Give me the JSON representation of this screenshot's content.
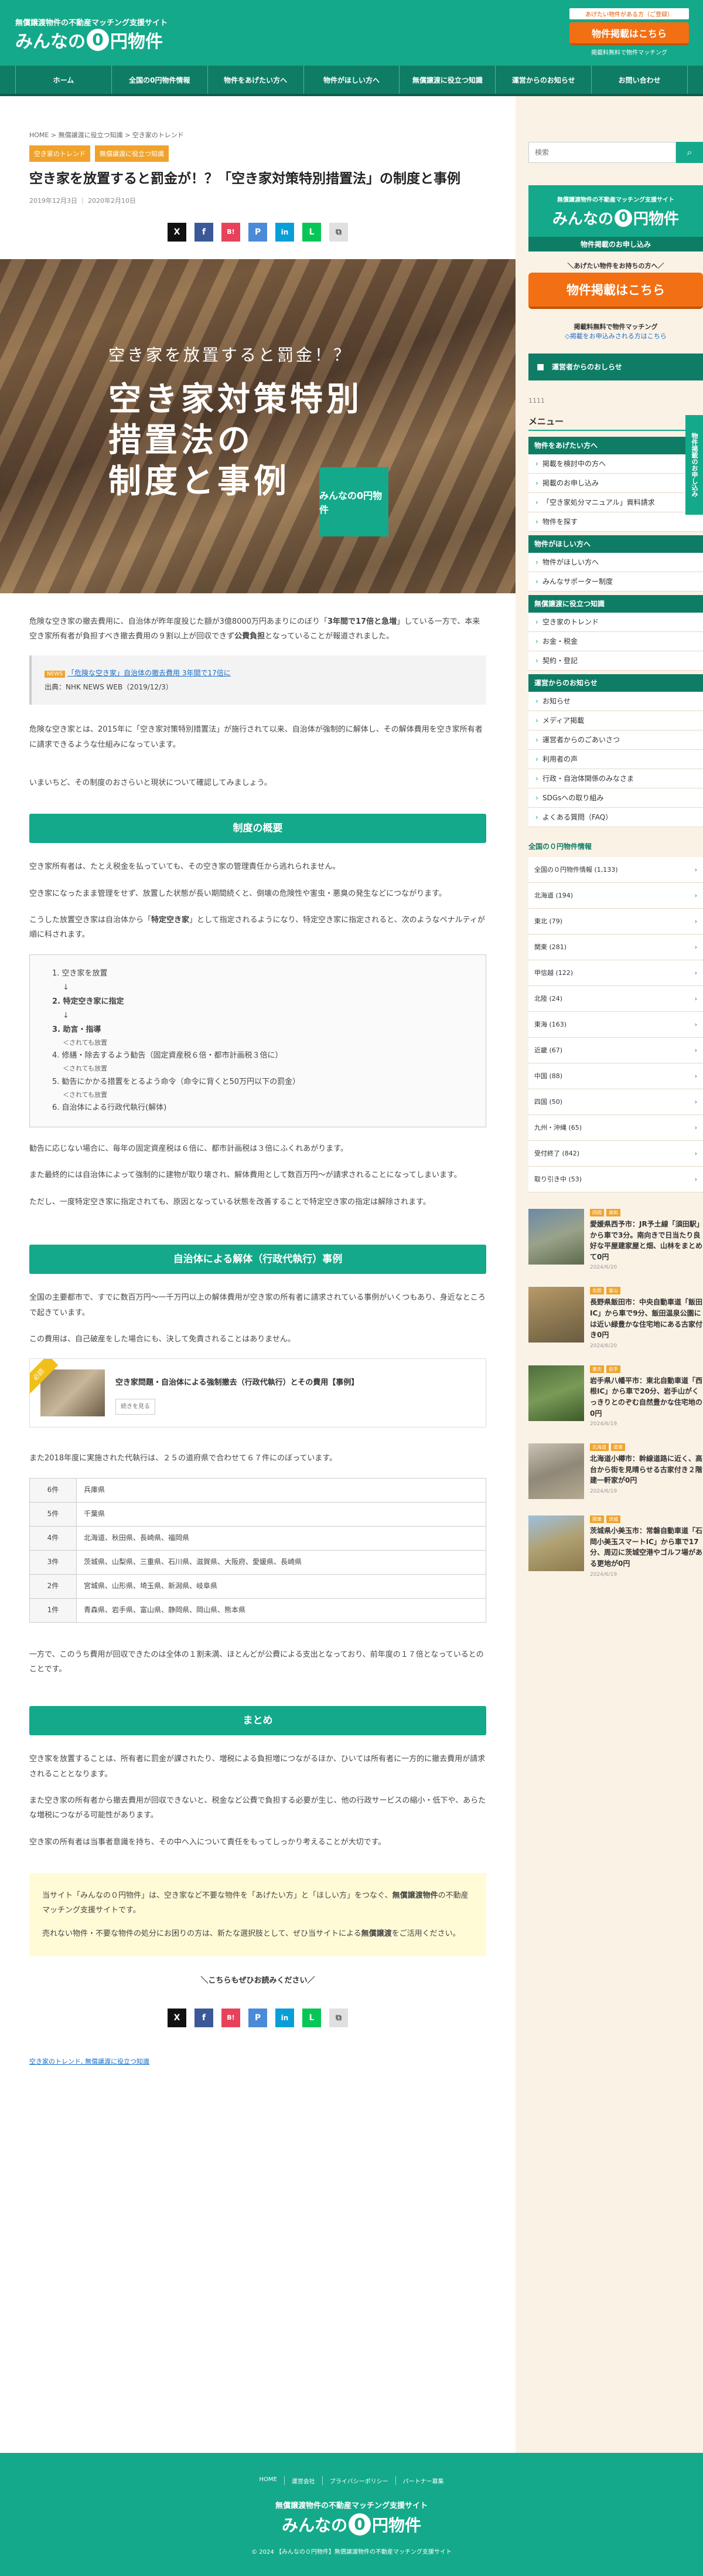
{
  "header": {
    "tagline": "無償譲渡物件の不動産マッチング支援サイト",
    "logo_pre": "みんなの",
    "logo_zero": "0",
    "logo_post": "円物件",
    "small": "あげたい物件がある方（ご登録）",
    "cta": "物件掲載はこちら",
    "cta_sub": "掲載料無料で物件マッチング"
  },
  "nav": [
    "ホーム",
    "全国の0円物件情報",
    "物件をあげたい方へ",
    "物件がほしい方へ",
    "無償譲渡に役立つ知識",
    "運営からのお知らせ",
    "お問い合わせ"
  ],
  "breadcrumb": "HOME > 無償譲渡に役立つ知識 > 空き家のトレンド",
  "tags": [
    "空き家のトレンド",
    "無償譲渡に役立つ知識"
  ],
  "title": "空き家を放置すると罰金が！？「空き家対策特別措置法」の制度と事例",
  "date": "2019年12月3日 ｜ 2020年2月10日",
  "share": [
    "X",
    "f",
    "B!",
    "P",
    "in",
    "L",
    "⧉"
  ],
  "hero": {
    "lead": "空き家を放置すると罰金！？",
    "lines": [
      "空き家対策特別",
      "措置法の",
      "制度と事例"
    ],
    "badge": "みんなの0円物件"
  },
  "intro": {
    "p1a": "危険な空き家の撤去費用に、自治体が昨年度投じた額が3億8000万円あまりにのぼり「",
    "p1b": "3年間で17倍と急増",
    "p1c": "」している一方で、本来空き家所有者が負担すべき撤去費用の９割以上が回収できず",
    "p1d": "公費負担",
    "p1e": "となっていることが報道されました。",
    "quote_tag": "",
    "quote_link": "「危険な空き家」自治体の撤去費用 3年間で17倍に",
    "quote_src": "出典：NHK NEWS WEB（2019/12/3）",
    "p2": "危険な空き家とは、2015年に「空き家対策特別措置法」が施行されて以来、自治体が強制的に解体し、その解体費用を空き家所有者に請求できるような仕組みになっています。",
    "p3": "いまいちど、その制度のおさらいと現状について確認してみましょう。"
  },
  "sec1": {
    "heading": "制度の概要",
    "p1": "空き家所有者は、たとえ税金を払っていても、その空き家の管理責任から逃れられません。",
    "p2": "空き家になったまま管理をせず、放置した状態が長い期間続くと、倒壊の危険性や害虫・悪臭の発生などにつながります。",
    "p3a": "こうした放置空き家は自治体から「",
    "p3b": "特定空き家",
    "p3c": "」として指定されるようになり、特定空き家に指定されると、次のようなペナルティが順に科されます。",
    "list": [
      {
        "text": "1. 空き家を放置",
        "note": ""
      },
      {
        "text": "2. 特定空き家に指定",
        "note": ""
      },
      {
        "text": "3. 助言・指導",
        "note": "＜されても放置"
      },
      {
        "text": "4. 修繕・除去するよう勧告（固定資産税６倍・都市計画税３倍に）",
        "note": "＜されても放置"
      },
      {
        "text": "5. 勧告にかかる措置をとるよう命令（命令に背くと50万円以下の罰金）",
        "note": "＜されても放置"
      },
      {
        "text": "6. 自治体による行政代執行(解体)",
        "note": ""
      }
    ],
    "arrow": "↓",
    "p4": "勧告に応じない場合に、毎年の固定資産税は６倍に、都市計画税は３倍にふくれあがります。",
    "p5": "また最終的には自治体によって強制的に建物が取り壊され、解体費用として数百万円～が請求されることになってしまいます。",
    "p6": "ただし、一度特定空き家に指定されても、原因となっている状態を改善することで特定空き家の指定は解除されます。"
  },
  "sec2": {
    "heading": "自治体による解体（行政代執行）事例",
    "p1": "全国の主要都市で、すでに数百万円〜一千万円以上の解体費用が空き家の所有者に請求されている事例がいくつもあり、身近なところで起きています。",
    "p2": "この費用は、自己破産をした場合にも、決して免責されることはありません。",
    "card_ribbon": "必読",
    "card_title": "空き家問題・自治体による強制撤去（行政代執行）とその費用【事例】",
    "card_btn": "続きを見る",
    "p3": "また2018年度に実施された代執行は、２５の道府県で合わせて６７件にのぼっています。",
    "table": [
      [
        "6件",
        "兵庫県"
      ],
      [
        "5件",
        "千葉県"
      ],
      [
        "4件",
        "北海道、秋田県、長崎県、福岡県"
      ],
      [
        "3件",
        "茨城県、山梨県、三重県、石川県、滋賀県、大阪府、愛媛県、長崎県"
      ],
      [
        "2件",
        "宮城県、山形県、埼玉県、新潟県、岐阜県"
      ],
      [
        "1件",
        "青森県、岩手県、富山県、静岡県、岡山県、熊本県"
      ]
    ],
    "p4": "一方で、このうち費用が回収できたのは全体の１割未満、ほとんどが公費による支出となっており、前年度の１７倍となっているとのことです。"
  },
  "sec3": {
    "heading": "まとめ",
    "p1": "空き家を放置することは、所有者に罰金が課されたり、増税による負担増につながるほか、ひいては所有者に一方的に撤去費用が請求されることとなります。",
    "p2": "また空き家の所有者から撤去費用が回収できないと、税金など公費で負担する必要が生じ、他の行政サービスの縮小・低下や、あらたな増税につながる可能性があります。",
    "p3": "空き家の所有者は当事者意識を持ち、その中へ入について責任をもってしっかり考えることが大切です。"
  },
  "yellow": {
    "p1a": "当サイト「みんなの０円物件」は、空き家など不要な物件を「あげたい方」と「ほしい方」をつなぐ、",
    "p1b": "無償譲渡物件",
    "p1c": "の不動産マッチング支援サイトです。",
    "p2a": "売れない物件・不要な物件の処分にお困りの方は、新たな選択肢として、ぜひ当サイトによる",
    "p2b": "無償譲渡",
    "p2c": "をご活用ください。"
  },
  "share_head": "＼こちらもぜひお読みください／",
  "category_link": "空き家のトレンド, 無償譲渡に役立つ知識",
  "sidebar": {
    "search_placeholder": "検索",
    "banner_t1": "無償譲渡物件の不動産マッチング支援サイト",
    "apply": "物件掲載のお申し込み",
    "give": "＼あげたい物件をお持ちの方へ／",
    "cta": "物件掲載はこちら",
    "free": "掲載料無料で物件マッチング",
    "free_link": "◇掲載をお申込みされる方はこちら",
    "news": "運営者からのおしらせ",
    "count": "1111",
    "menu_h": "メニュー",
    "menu": [
      {
        "group": "物件をあげたい方へ",
        "items": [
          "掲載を検討中の方へ",
          "掲載のお申し込み",
          "「空き家処分マニュアル」資料請求",
          "物件を探す"
        ]
      },
      {
        "group": "物件がほしい方へ",
        "items": [
          "物件がほしい方へ",
          "みんなサポーター制度"
        ]
      },
      {
        "group": "無償譲渡に役立つ知識",
        "items": [
          "空き家のトレンド",
          "お金・税金",
          "契約・登記"
        ]
      },
      {
        "group": "運営からのお知らせ",
        "items": [
          "お知らせ",
          "メディア掲載",
          "運営者からのごあいさつ",
          "利用者の声",
          "行政・自治体関係のみなさま",
          "SDGsへの取り組み",
          "よくある質問（FAQ）"
        ]
      }
    ],
    "areas_h": "全国の０円物件情報",
    "areas": [
      "全国の０円物件情報 (1,133)",
      "北海道 (194)",
      "東北 (79)",
      "関東 (281)",
      "甲信越 (122)",
      "北陸 (24)",
      "東海 (163)",
      "近畿 (67)",
      "中国 (88)",
      "四国 (50)",
      "九州・沖縄 (65)",
      "受付終了 (842)",
      "取り引き中 (53)"
    ],
    "posts": [
      {
        "tags": [
          "四国",
          "高知"
        ],
        "title": "愛媛県西予市：JR予土線「須田駅」から車で3分。南向きで日当たり良好な平屋建家屋と畑、山林をまとめて0円",
        "date": "2024/6/20"
      },
      {
        "tags": [
          "北陸",
          "富山"
        ],
        "title": "長野県飯田市：中央自動車道「飯田IC」から車で9分、飯田温泉公園には近い緑豊かな住宅地にある古家付き0円",
        "date": "2024/6/20"
      },
      {
        "tags": [
          "東北",
          "岩手"
        ],
        "title": "岩手県八幡平市：東北自動車道「西根IC」から車で20分、岩手山がくっきりとのぞむ自然豊かな住宅地の0円",
        "date": "2024/6/19"
      },
      {
        "tags": [
          "北海道",
          "道東"
        ],
        "title": "北海道小樽市：幹線道路に近く、高台から街を見晴らせる古家付き２階建一軒家が0円",
        "date": "2024/6/19"
      },
      {
        "tags": [
          "関東",
          "茨城"
        ],
        "title": "茨城県小美玉市：常磐自動車道「石岡小美玉スマートIC」から車で17分、周辺に茨城空港やゴルフ場がある更地が0円",
        "date": "2024/6/19"
      }
    ],
    "side_tab": "物件掲載のお申し込み"
  },
  "footer": {
    "links": [
      "HOME",
      "運営会社",
      "プライバシーポリシー",
      "パートナー募集"
    ],
    "tagline": "無償譲渡物件の不動産マッチング支援サイト",
    "copy": "© 2024 【みんなの０円物件】無償譲渡物件の不動産マッチング支援サイト"
  },
  "colors": {
    "brand": "#14a98a",
    "brand_dark": "#0f7d66",
    "accent": "#f26f13",
    "tag": "#f0a32c"
  }
}
